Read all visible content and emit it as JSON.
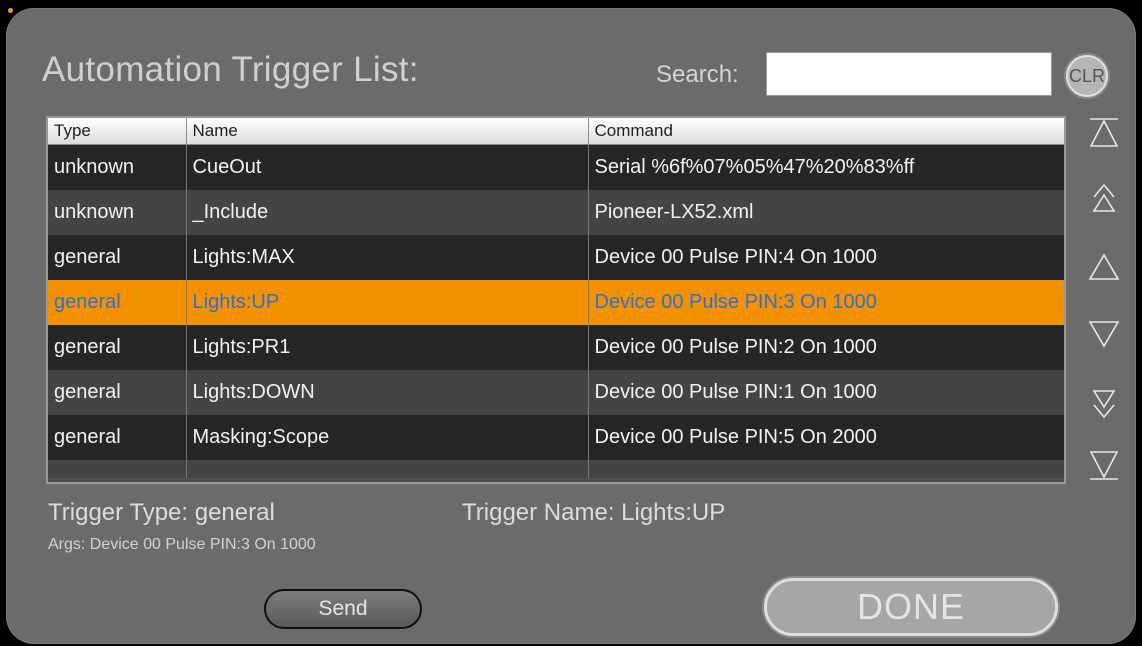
{
  "dialog": {
    "title": "Automation Trigger List:",
    "search_label": "Search:",
    "search_value": "",
    "clear_label": "CLR"
  },
  "table": {
    "headers": [
      "Type",
      "Name",
      "Command"
    ],
    "rows": [
      {
        "type": "unknown",
        "name": "CueOut",
        "command": "Serial %6f%07%05%47%20%83%ff"
      },
      {
        "type": "unknown",
        "name": "_Include",
        "command": "Pioneer-LX52.xml"
      },
      {
        "type": "general",
        "name": "Lights:MAX",
        "command": "Device 00 Pulse PIN:4 On 1000"
      },
      {
        "type": "general",
        "name": "Lights:UP",
        "command": "Device 00 Pulse PIN:3 On 1000"
      },
      {
        "type": "general",
        "name": "Lights:PR1",
        "command": "Device 00 Pulse PIN:2 On 1000"
      },
      {
        "type": "general",
        "name": "Lights:DOWN",
        "command": "Device 00 Pulse PIN:1 On 1000"
      },
      {
        "type": "general",
        "name": "Masking:Scope",
        "command": "Device 00 Pulse PIN:5 On 2000"
      }
    ],
    "selected_index": 3
  },
  "scroll": {
    "icons": [
      "scroll-top-icon",
      "page-up-icon",
      "line-up-icon",
      "line-down-icon",
      "page-down-icon",
      "scroll-bottom-icon"
    ]
  },
  "details": {
    "type_text": "Trigger Type: general",
    "name_text": "Trigger Name: Lights:UP",
    "args_text": "Args: Device 00 Pulse PIN:3 On 1000"
  },
  "buttons": {
    "send_label": "Send",
    "done_label": "DONE"
  },
  "colors": {
    "selected_row_bg": "#f39200",
    "selected_row_text": "#2f6fd6",
    "panel_bg": "#6b6b6b"
  }
}
